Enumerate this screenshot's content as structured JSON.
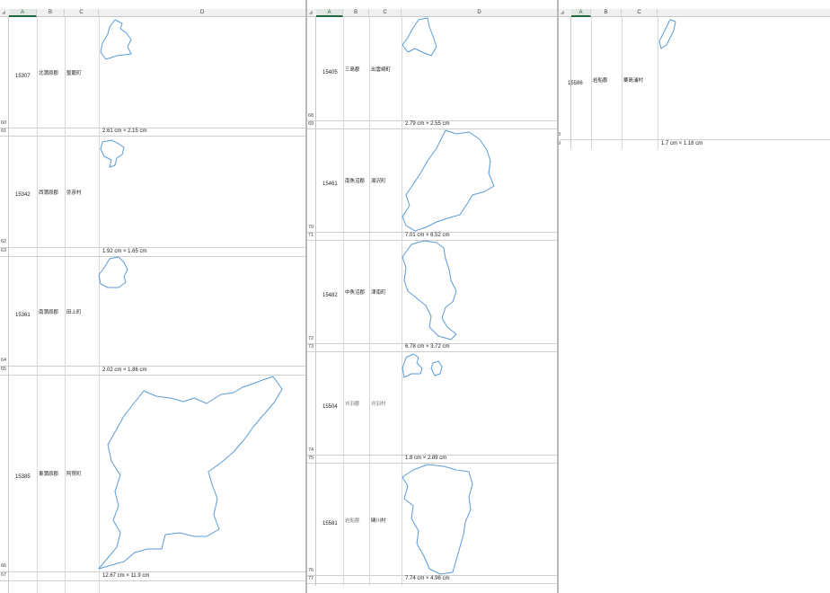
{
  "columns": [
    "A",
    "B",
    "C",
    "D"
  ],
  "pane1": {
    "rows": [
      {
        "code": "15307",
        "gun": "北蒲原郡",
        "town": "聖籠町",
        "size": "2.61 cm × 2.15 cm",
        "row_top": "60",
        "row_bottom": "61"
      },
      {
        "code": "15342",
        "gun": "西蒲原郡",
        "town": "弥彦村",
        "size": "1.92 cm × 1.65 cm",
        "row_top": "62",
        "row_bottom": "63"
      },
      {
        "code": "15361",
        "gun": "南蒲原郡",
        "town": "田上町",
        "size": "2.02 cm × 1.86 cm",
        "row_top": "64",
        "row_bottom": "65"
      },
      {
        "code": "15385",
        "gun": "東蒲原郡",
        "town": "阿賀町",
        "size": "12.67 cm × 11.9 cm",
        "row_top": "66",
        "row_bottom": "67"
      }
    ]
  },
  "pane2": {
    "rows": [
      {
        "code": "15405",
        "gun": "三島郡",
        "town": "出雲崎町",
        "size": "2.79 cm × 2.55 cm",
        "row_top": "68",
        "row_bottom": "69"
      },
      {
        "code": "15461",
        "gun": "南魚沼郡",
        "town": "湯沢町",
        "size": "7.01 cm × 6.52 cm",
        "row_top": "70",
        "row_bottom": "71"
      },
      {
        "code": "15482",
        "gun": "中魚沼郡",
        "town": "津南町",
        "size": "6.78 cm × 3.72 cm",
        "row_top": "72",
        "row_bottom": "73"
      },
      {
        "code": "15504",
        "gun": "刈羽郡",
        "town": "刈羽村",
        "size": "1.8 cm × 2.89 cm",
        "row_top": "74",
        "row_bottom": "75"
      },
      {
        "code": "15581",
        "gun": "岩船郡",
        "town": "関川村",
        "size": "7.74 cm × 4.96 cm",
        "row_top": "76",
        "row_bottom": "77"
      }
    ]
  },
  "pane3": {
    "rows": [
      {
        "code": "15586",
        "gun": "岩船郡",
        "town": "粟島浦村",
        "size": "1.7 cm × 1.18 cm",
        "row_top": "8",
        "row_bottom": "9"
      }
    ]
  }
}
